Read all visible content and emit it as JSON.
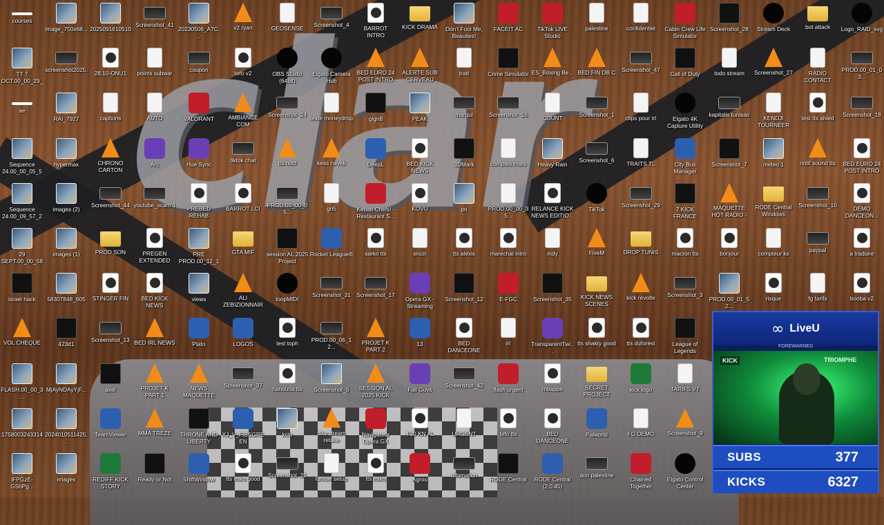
{
  "desktop": {
    "icons": [
      {
        "label": "courses",
        "kind": "k-blank"
      },
      {
        "label": "image_750x68...",
        "kind": "k-img"
      },
      {
        "label": "2025091610510...",
        "kind": "k-img"
      },
      {
        "label": "Screenshot_41",
        "kind": "k-screen"
      },
      {
        "label": "20230506_A7C...",
        "kind": "k-img"
      },
      {
        "label": "v2 ryan",
        "kind": "k-vlc"
      },
      {
        "label": "GEOSENSE",
        "kind": "k-file"
      },
      {
        "label": "Screenshot_4",
        "kind": "k-screen"
      },
      {
        "label": "BARROT INTRO",
        "kind": "k-media"
      },
      {
        "label": "KICK DRAMA",
        "kind": "k-folder"
      },
      {
        "label": "Don't Fool Me, Beauties!",
        "kind": "k-img"
      },
      {
        "label": "FACEIT AC",
        "kind": "k-red"
      },
      {
        "label": "TikTok LIVE Studio",
        "kind": "k-red"
      },
      {
        "label": "palestine",
        "kind": "k-file"
      },
      {
        "label": "confidentiel",
        "kind": "k-file"
      },
      {
        "label": "Cabin Crew Life Simulator",
        "kind": "k-red"
      },
      {
        "label": "Screenshot_28",
        "kind": "k-dark"
      },
      {
        "label": "Stream Deck",
        "kind": "k-black"
      },
      {
        "label": "bot attack",
        "kind": "k-folder"
      },
      {
        "label": "Logo_RAID_svg",
        "kind": "k-black"
      },
      {
        "label": "TT 7 OCT.00_00_29_...",
        "kind": "k-img"
      },
      {
        "label": "screenshot2025...",
        "kind": "k-screen"
      },
      {
        "label": "28.10-ONU1",
        "kind": "k-media"
      },
      {
        "label": "points subwar",
        "kind": "k-file"
      },
      {
        "label": "coupon",
        "kind": "k-screen"
      },
      {
        "label": "tefo v2",
        "kind": "k-media"
      },
      {
        "label": "OBS Studio (64bit)",
        "kind": "k-black"
      },
      {
        "label": "Elgato Camera Hub",
        "kind": "k-black"
      },
      {
        "label": "BED EURO 24 POST INTRO",
        "kind": "k-vlc"
      },
      {
        "label": "ALERTE SUB CERVEAU",
        "kind": "k-vlc"
      },
      {
        "label": "trad",
        "kind": "k-file"
      },
      {
        "label": "Crime Simulator",
        "kind": "k-dark"
      },
      {
        "label": "ES_Boxing Be...",
        "kind": "k-vlc"
      },
      {
        "label": "BED FIN DB C",
        "kind": "k-vlc"
      },
      {
        "label": "Screenshot_47",
        "kind": "k-screen"
      },
      {
        "label": "Call of Duty",
        "kind": "k-dark"
      },
      {
        "label": "todo stream",
        "kind": "k-file"
      },
      {
        "label": "Screenshot_27",
        "kind": "k-vlc"
      },
      {
        "label": "RADIO CONTACT",
        "kind": "k-file"
      },
      {
        "label": "PROD.00_01_03...",
        "kind": "k-screen"
      },
      {
        "label": "ae",
        "kind": "k-blank"
      },
      {
        "label": "RAI_7927",
        "kind": "k-img"
      },
      {
        "label": "captions",
        "kind": "k-file"
      },
      {
        "label": "AUTO",
        "kind": "k-file"
      },
      {
        "label": "VALORANT",
        "kind": "k-red"
      },
      {
        "label": "AMBIANCE COM",
        "kind": "k-vlc"
      },
      {
        "label": "Screenshot_24",
        "kind": "k-screen"
      },
      {
        "label": "texte moneydrop",
        "kind": "k-file"
      },
      {
        "label": "gign8",
        "kind": "k-dark"
      },
      {
        "label": "PEAK",
        "kind": "k-img"
      },
      {
        "label": "marqui",
        "kind": "k-screen"
      },
      {
        "label": "Screenshot_16",
        "kind": "k-screen"
      },
      {
        "label": "COUNT",
        "kind": "k-file"
      },
      {
        "label": "Screenshot_1",
        "kind": "k-screen"
      },
      {
        "label": "clips pour irl",
        "kind": "k-file"
      },
      {
        "label": "Elgato 4K Capture Utility",
        "kind": "k-black"
      },
      {
        "label": "kapitalis tunisair",
        "kind": "k-screen"
      },
      {
        "label": "KENDJI TOURNEER",
        "kind": "k-file"
      },
      {
        "label": "test tts ahled",
        "kind": "k-media"
      },
      {
        "label": "Screenshot_18",
        "kind": "k-screen"
      },
      {
        "label": "Sequence 24.00_00_05_55...",
        "kind": "k-img"
      },
      {
        "label": "hypermax",
        "kind": "k-img"
      },
      {
        "label": "CHRONO CARTON JAUNE",
        "kind": "k-vlc"
      },
      {
        "label": "Arc",
        "kind": "k-purple"
      },
      {
        "label": "Hue Sync",
        "kind": "k-purple"
      },
      {
        "label": "tiktok chat",
        "kind": "k-screen"
      },
      {
        "label": "tts notif",
        "kind": "k-vlc"
      },
      {
        "label": "kess nayek",
        "kind": "k-vlc"
      },
      {
        "label": "DeepL",
        "kind": "k-app"
      },
      {
        "label": "BED KICK NEWS BREAKING TIM...",
        "kind": "k-media"
      },
      {
        "label": "3DMark",
        "kind": "k-dark"
      },
      {
        "label": "comptes mars",
        "kind": "k-file"
      },
      {
        "label": "Heavy Rain",
        "kind": "k-img"
      },
      {
        "label": "Screenshot_6",
        "kind": "k-screen"
      },
      {
        "label": "TRAITS TL",
        "kind": "k-file"
      },
      {
        "label": "City Bus Manager",
        "kind": "k-app"
      },
      {
        "label": "Screenshot_7",
        "kind": "k-dark"
      },
      {
        "label": "meteo 1",
        "kind": "k-img"
      },
      {
        "label": "notif sound tts",
        "kind": "k-vlc"
      },
      {
        "label": "BED EURO 24 POST INTRO",
        "kind": "k-media"
      },
      {
        "label": "Sequence 24.00_09_57_28...",
        "kind": "k-img"
      },
      {
        "label": "images (2)",
        "kind": "k-img"
      },
      {
        "label": "Screenshot_44",
        "kind": "k-screen"
      },
      {
        "label": "youtube_scam 1",
        "kind": "k-screen"
      },
      {
        "label": "PREBED REHAB",
        "kind": "k-media"
      },
      {
        "label": "BARROT LCI",
        "kind": "k-media"
      },
      {
        "label": "PROD.00_00_05...",
        "kind": "k-screen"
      },
      {
        "label": "gn5",
        "kind": "k-file"
      },
      {
        "label": "Kebab Chefs! - Restaurant S...",
        "kind": "k-red"
      },
      {
        "label": "KOVU",
        "kind": "k-media"
      },
      {
        "label": "pn",
        "kind": "k-img"
      },
      {
        "label": "PROD.00_00_35...",
        "kind": "k-file"
      },
      {
        "label": "RELANCE KICK NEWS EDITIO...",
        "kind": "k-media"
      },
      {
        "label": "TikTok",
        "kind": "k-black"
      },
      {
        "label": "Screenshot_29",
        "kind": "k-screen"
      },
      {
        "label": "7 KICK FRANCE",
        "kind": "k-dark"
      },
      {
        "label": "MAQUETTE HOT RADIO - EL HE...",
        "kind": "k-vlc"
      },
      {
        "label": "RODE Central Windows v2.0.45",
        "kind": "k-folder"
      },
      {
        "label": "Screenshot_10",
        "kind": "k-screen"
      },
      {
        "label": "DEMO DANCEON...",
        "kind": "k-media"
      },
      {
        "label": "29 SEPT.00_00_58_...",
        "kind": "k-img"
      },
      {
        "label": "images (1)",
        "kind": "k-img"
      },
      {
        "label": "PROD SON",
        "kind": "k-folder"
      },
      {
        "label": "PREGEN EXTENDED",
        "kind": "k-media"
      },
      {
        "label": "PRE PROD.00_12_13...",
        "kind": "k-img"
      },
      {
        "label": "GTA MIF",
        "kind": "k-folder"
      },
      {
        "label": "session AL 2025 Project",
        "kind": "k-dark"
      },
      {
        "label": "Rocket League®",
        "kind": "k-app"
      },
      {
        "label": "sarko tts",
        "kind": "k-media"
      },
      {
        "label": "sncin",
        "kind": "k-file"
      },
      {
        "label": "tts alexis",
        "kind": "k-media"
      },
      {
        "label": "marechal intro",
        "kind": "k-media"
      },
      {
        "label": "indy",
        "kind": "k-file"
      },
      {
        "label": "FiveM",
        "kind": "k-vlc"
      },
      {
        "label": "DROP TUNIS",
        "kind": "k-folder"
      },
      {
        "label": "macron tts",
        "kind": "k-media"
      },
      {
        "label": "bonjour",
        "kind": "k-media"
      },
      {
        "label": "compteur ks",
        "kind": "k-file"
      },
      {
        "label": "paypal",
        "kind": "k-screen"
      },
      {
        "label": "a traduire",
        "kind": "k-media"
      },
      {
        "label": "israel hack",
        "kind": "k-dark"
      },
      {
        "label": "58307848_605",
        "kind": "k-img"
      },
      {
        "label": "STINGER FIN",
        "kind": "k-media"
      },
      {
        "label": "BED KICK NEWS BREAKING TIM...",
        "kind": "k-media"
      },
      {
        "label": "views",
        "kind": "k-img"
      },
      {
        "label": "ALI ZEBIZIONNAIRE",
        "kind": "k-vlc"
      },
      {
        "label": "loopMIDI",
        "kind": "k-black"
      },
      {
        "label": "Screenshot_31",
        "kind": "k-screen"
      },
      {
        "label": "Screenshot_17",
        "kind": "k-screen"
      },
      {
        "label": "Opera GX - Streaming",
        "kind": "k-purple"
      },
      {
        "label": "Screenshot_12",
        "kind": "k-dark"
      },
      {
        "label": "E-FGC",
        "kind": "k-red"
      },
      {
        "label": "Screenshot_35",
        "kind": "k-dark"
      },
      {
        "label": "KICK NEWS SCENES",
        "kind": "k-folder"
      },
      {
        "label": "kick revolte",
        "kind": "k-vlc"
      },
      {
        "label": "Screenshot_3",
        "kind": "k-screen"
      },
      {
        "label": "PROD.00_01_52...",
        "kind": "k-img"
      },
      {
        "label": "risque",
        "kind": "k-media"
      },
      {
        "label": "fg tarifs",
        "kind": "k-file"
      },
      {
        "label": "booba v2",
        "kind": "k-media"
      },
      {
        "label": "VOL CHEQUE",
        "kind": "k-vlc"
      },
      {
        "label": "423d1",
        "kind": "k-dark"
      },
      {
        "label": "Screenshot_13",
        "kind": "k-screen"
      },
      {
        "label": "BED IRL NEWS",
        "kind": "k-vlc"
      },
      {
        "label": "Plato",
        "kind": "k-app"
      },
      {
        "label": "LOGOS",
        "kind": "k-app"
      },
      {
        "label": "test toph",
        "kind": "k-media"
      },
      {
        "label": "PROD.00_06_12...",
        "kind": "k-screen"
      },
      {
        "label": "PROJET K PART 2",
        "kind": "k-vlc"
      },
      {
        "label": "13",
        "kind": "k-app"
      },
      {
        "label": "BED DANCEONE POWER",
        "kind": "k-media"
      },
      {
        "label": "irl",
        "kind": "k-file"
      },
      {
        "label": "TransparentTwi...",
        "kind": "k-purple"
      },
      {
        "label": "tts shakty good",
        "kind": "k-media"
      },
      {
        "label": "tts duforest",
        "kind": "k-media"
      },
      {
        "label": "League of Legends",
        "kind": "k-dark"
      },
      {
        "label": "",
        "kind": "k-blank"
      },
      {
        "label": "",
        "kind": "k-blank"
      },
      {
        "label": "",
        "kind": "k-blank"
      },
      {
        "label": "",
        "kind": "k-blank"
      },
      {
        "label": "FLASH.00_00_3...",
        "kind": "k-img"
      },
      {
        "label": "MjAyNDAyYjF...",
        "kind": "k-img"
      },
      {
        "label": "axel",
        "kind": "k-dark"
      },
      {
        "label": "PROJET K PART 1",
        "kind": "k-vlc"
      },
      {
        "label": "NEWS MAQUETTE M...",
        "kind": "k-vlc"
      },
      {
        "label": "Screenshot_37",
        "kind": "k-screen"
      },
      {
        "label": "hanouna tts",
        "kind": "k-media"
      },
      {
        "label": "Screenshot_5",
        "kind": "k-img"
      },
      {
        "label": "SESSION AL 2025 KICK AHMED",
        "kind": "k-vlc"
      },
      {
        "label": "Fall Guys",
        "kind": "k-purple"
      },
      {
        "label": "Screenshot_42",
        "kind": "k-screen"
      },
      {
        "label": "flash urgent",
        "kind": "k-red"
      },
      {
        "label": "mbappe",
        "kind": "k-media"
      },
      {
        "label": "SECRET PROJECT LNDY CORP",
        "kind": "k-folder"
      },
      {
        "label": "kick logo",
        "kind": "k-green"
      },
      {
        "label": "TARIFS VT",
        "kind": "k-file"
      },
      {
        "label": "",
        "kind": "k-blank"
      },
      {
        "label": "",
        "kind": "k-blank"
      },
      {
        "label": "",
        "kind": "k-blank"
      },
      {
        "label": "",
        "kind": "k-blank"
      },
      {
        "label": "1758003243314",
        "kind": "k-img"
      },
      {
        "label": "2024010511425...",
        "kind": "k-img"
      },
      {
        "label": "TeamViewer",
        "kind": "k-app"
      },
      {
        "label": "MMA TREZE",
        "kind": "k-vlc"
      },
      {
        "label": "THRONE AND LIBERTY",
        "kind": "k-dark"
      },
      {
        "label": "XJ_V_FIBSGREEN",
        "kind": "k-app"
      },
      {
        "label": "kcip",
        "kind": "k-img"
      },
      {
        "label": "dice dream retake",
        "kind": "k-vlc"
      },
      {
        "label": "Navigateur Opera GX",
        "kind": "k-red"
      },
      {
        "label": "4'30 KN AL",
        "kind": "k-media"
      },
      {
        "label": "URGENT",
        "kind": "k-file"
      },
      {
        "label": "tefo tts",
        "kind": "k-media"
      },
      {
        "label": "BED DANCEONE DAFT PUNK",
        "kind": "k-media"
      },
      {
        "label": "Palworld",
        "kind": "k-app"
      },
      {
        "label": "FG DEMO",
        "kind": "k-file"
      },
      {
        "label": "Screenshot_9",
        "kind": "k-vlc"
      },
      {
        "label": "",
        "kind": "k-blank"
      },
      {
        "label": "",
        "kind": "k-blank"
      },
      {
        "label": "",
        "kind": "k-blank"
      },
      {
        "label": "",
        "kind": "k-blank"
      },
      {
        "label": "iFPGzE-GSnPg...",
        "kind": "k-img"
      },
      {
        "label": "images",
        "kind": "k-img"
      },
      {
        "label": "REDIFF KICK STORY WARRI...",
        "kind": "k-green"
      },
      {
        "label": "Ready or Not",
        "kind": "k-dark"
      },
      {
        "label": "ShiftWindow",
        "kind": "k-app"
      },
      {
        "label": "tts miko good",
        "kind": "k-media"
      },
      {
        "label": "Screenshot_25",
        "kind": "k-screen"
      },
      {
        "label": "tunisie setup",
        "kind": "k-file"
      },
      {
        "label": "tts miko",
        "kind": "k-media"
      },
      {
        "label": "Agrou",
        "kind": "k-red"
      },
      {
        "label": "difamation",
        "kind": "k-screen"
      },
      {
        "label": "RODE Central",
        "kind": "k-dark"
      },
      {
        "label": "RODE Central (2.0.45)",
        "kind": "k-app"
      },
      {
        "label": "don palestine",
        "kind": "k-screen"
      },
      {
        "label": "Chained Together",
        "kind": "k-red"
      },
      {
        "label": "Elgato Control Center",
        "kind": "k-black"
      },
      {
        "label": "",
        "kind": "k-blank"
      },
      {
        "label": "",
        "kind": "k-blank"
      },
      {
        "label": "",
        "kind": "k-blank"
      },
      {
        "label": "",
        "kind": "k-blank"
      }
    ]
  },
  "overlay": {
    "brand": "LiveU",
    "tagline": "FOREWARNED",
    "cam_sign_left": "KICK",
    "cam_sign_right": "TRIOMPHE",
    "subs_label": "SUBS",
    "subs_value": "377",
    "kicks_label": "KICKS",
    "kicks_value": "6327"
  },
  "wallpaper": {
    "watermark_text": "clar"
  }
}
